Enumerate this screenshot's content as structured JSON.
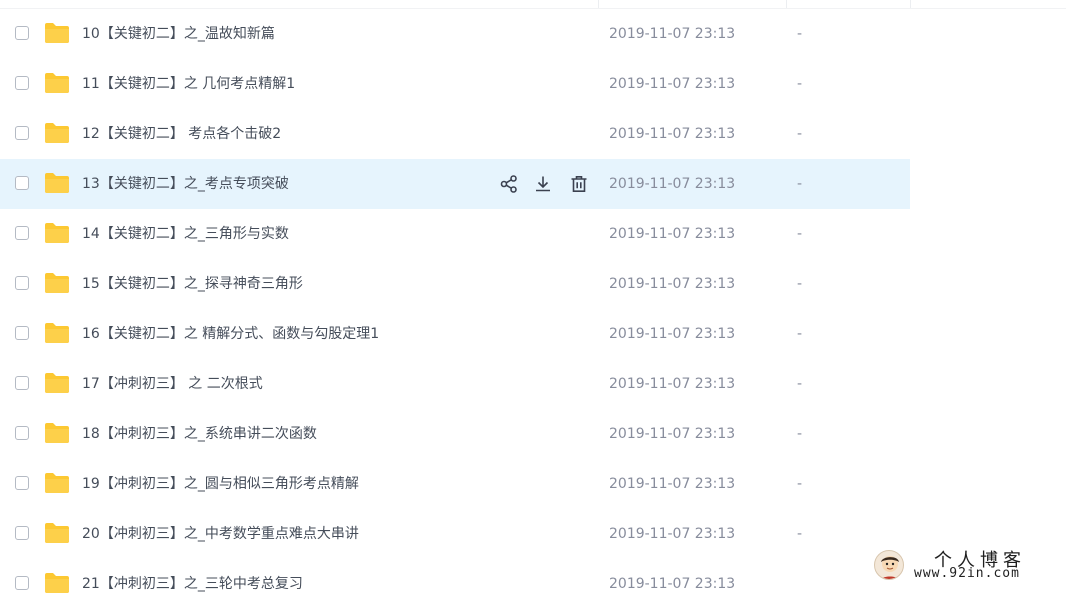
{
  "files": [
    {
      "name": "10【关键初二】之_温故知新篇",
      "modified": "2019-11-07 23:13",
      "size": "-"
    },
    {
      "name": "11【关键初二】之 几何考点精解1",
      "modified": "2019-11-07 23:13",
      "size": "-"
    },
    {
      "name": "12【关键初二】 考点各个击破2",
      "modified": "2019-11-07 23:13",
      "size": "-"
    },
    {
      "name": "13【关键初二】之_考点专项突破",
      "modified": "2019-11-07 23:13",
      "size": "-"
    },
    {
      "name": "14【关键初二】之_三角形与实数",
      "modified": "2019-11-07 23:13",
      "size": "-"
    },
    {
      "name": "15【关键初二】之_探寻神奇三角形",
      "modified": "2019-11-07 23:13",
      "size": "-"
    },
    {
      "name": "16【关键初二】之 精解分式、函数与勾股定理1",
      "modified": "2019-11-07 23:13",
      "size": "-"
    },
    {
      "name": "17【冲刺初三】 之 二次根式",
      "modified": "2019-11-07 23:13",
      "size": "-"
    },
    {
      "name": "18【冲刺初三】之_系统串讲二次函数",
      "modified": "2019-11-07 23:13",
      "size": "-"
    },
    {
      "name": "19【冲刺初三】之_圆与相似三角形考点精解",
      "modified": "2019-11-07 23:13",
      "size": "-"
    },
    {
      "name": "20【冲刺初三】之_中考数学重点难点大串讲",
      "modified": "2019-11-07 23:13",
      "size": "-"
    },
    {
      "name": "21【冲刺初三】之_三轮中考总复习",
      "modified": "2019-11-07 23:13",
      "size": ""
    }
  ],
  "row_actions": {
    "share_icon": "share-icon",
    "download_icon": "download-icon",
    "delete_icon": "trash-icon"
  },
  "watermark": {
    "title": "个人博客",
    "url": "www.92in.com"
  },
  "colors": {
    "folder": "#fcc832",
    "hover_row": "#e6f4fd",
    "text": "#454d5a",
    "muted": "#878c9c"
  }
}
